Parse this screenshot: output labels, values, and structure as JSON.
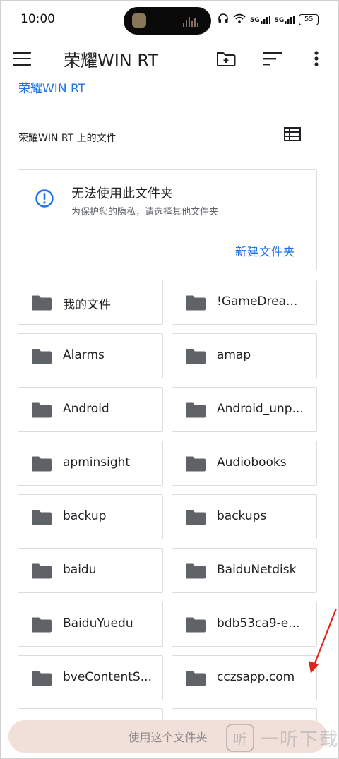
{
  "status_bar": {
    "time": "10:00",
    "signal1": "5G",
    "signal2": "5G",
    "battery": "55"
  },
  "app_bar": {
    "title": "荣耀WIN RT"
  },
  "breadcrumb": "荣耀WIN RT",
  "files_heading": "荣耀WIN RT 上的文件",
  "warning_card": {
    "title": "无法使用此文件夹",
    "subtitle": "为保护您的隐私，请选择其他文件夹",
    "action": "新建文件夹"
  },
  "folders": [
    "我的文件",
    "!GameDrea...",
    "Alarms",
    "amap",
    "Android",
    "Android_unp...",
    "apminsight",
    "Audiobooks",
    "backup",
    "backups",
    "baidu",
    "BaiduNetdisk",
    "BaiduYuedu",
    "bdb53ca9-e...",
    "bveContentS...",
    "cczsapp.com"
  ],
  "bottom_button": "使用这个文件夹",
  "watermark": {
    "logo": "听",
    "text": "一听下载"
  },
  "colors": {
    "accent": "#1a73e8",
    "folder_icon": "#5f6368",
    "annotation_arrow": "#e0241b"
  },
  "icons": {
    "menu": "menu-icon",
    "new_folder": "create-new-folder-icon",
    "sort": "sort-icon",
    "more": "more-vert-icon",
    "grid": "list-view-icon",
    "info": "info-icon",
    "folder": "folder-icon"
  }
}
